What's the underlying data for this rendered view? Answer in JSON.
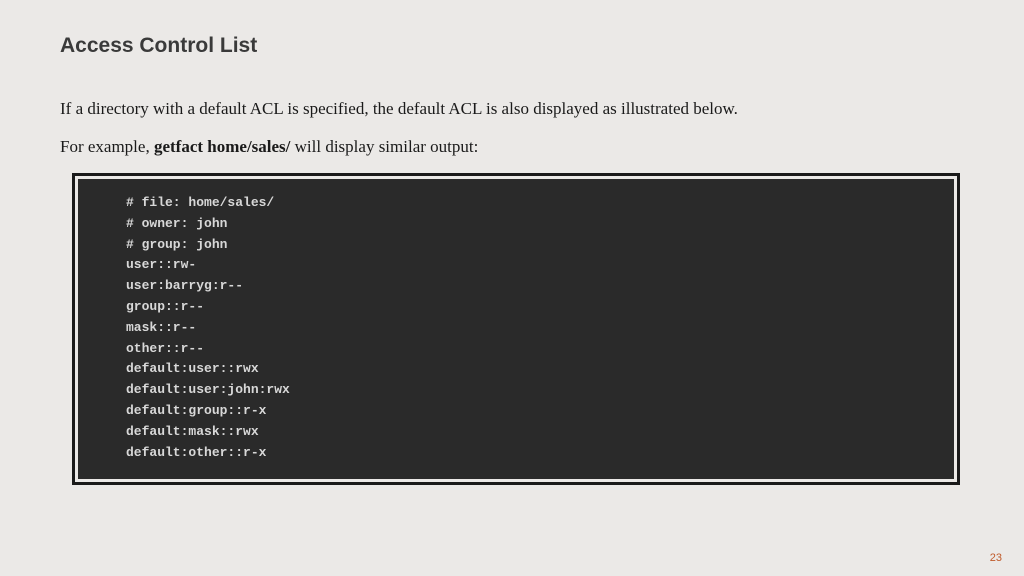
{
  "slide": {
    "title": "Access Control List",
    "paragraph1": "If a directory with a default ACL is specified, the default ACL is also displayed as illustrated below.",
    "paragraph2_pre": "For example, ",
    "paragraph2_bold": "getfact home/sales/",
    "paragraph2_post": "  will display similar output:",
    "terminal_lines": [
      "# file: home/sales/",
      "# owner: john",
      "# group: john",
      "user::rw-",
      "user:barryg:r--",
      "group::r--",
      "mask::r--",
      "other::r--",
      "default:user::rwx",
      "default:user:john:rwx",
      "default:group::r-x",
      "default:mask::rwx",
      "default:other::r-x"
    ],
    "page_number": "23"
  }
}
